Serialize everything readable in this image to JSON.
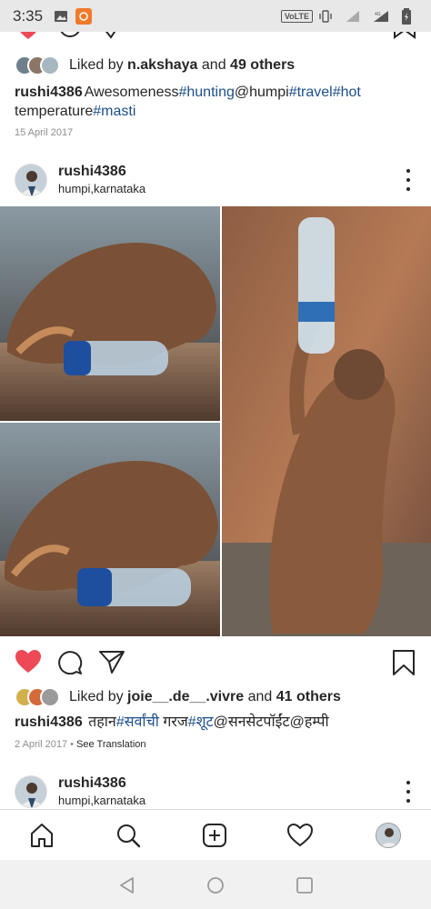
{
  "status_bar": {
    "time": "3:35",
    "network": "4G",
    "volte": "VoLTE"
  },
  "post1": {
    "liked_by_prefix": "Liked by",
    "liked_by_user": "n.akshaya",
    "liked_by_suffix": "and",
    "liked_by_count": "49 others",
    "caption_user": "rushi4386",
    "caption_parts": [
      "Awesomeness",
      "#hunting",
      "@humpi",
      "#travel",
      "#hot",
      "temperature",
      "#masti"
    ],
    "date": "15 April 2017"
  },
  "post2": {
    "username": "rushi4386",
    "location": "humpi,karnataka",
    "liked_by_prefix": "Liked by",
    "liked_by_user": "joie__.de__.vivre",
    "liked_by_suffix": "and",
    "liked_by_count": "41 others",
    "caption_user": "rushi4386",
    "caption_parts": [
      "तहान",
      "#सर्वांची",
      "गरज",
      "#शूट",
      "@सनसेटपॉईंट",
      "@हम्पी"
    ],
    "date": "2 April 2017",
    "separator": "•",
    "see_translation": "See Translation"
  },
  "post3": {
    "username": "rushi4386",
    "location": "humpi,karnataka"
  },
  "icons": {
    "like": "heart-icon",
    "comment": "comment-icon",
    "share": "send-icon",
    "save": "bookmark-icon",
    "home": "home-icon",
    "search": "search-icon",
    "add": "add-icon",
    "activity": "heart-outline-icon"
  },
  "colors": {
    "liked_heart": "#ed4956",
    "hashtag": "#1d4f8b",
    "text": "#262626",
    "muted": "#8e8e8e"
  }
}
